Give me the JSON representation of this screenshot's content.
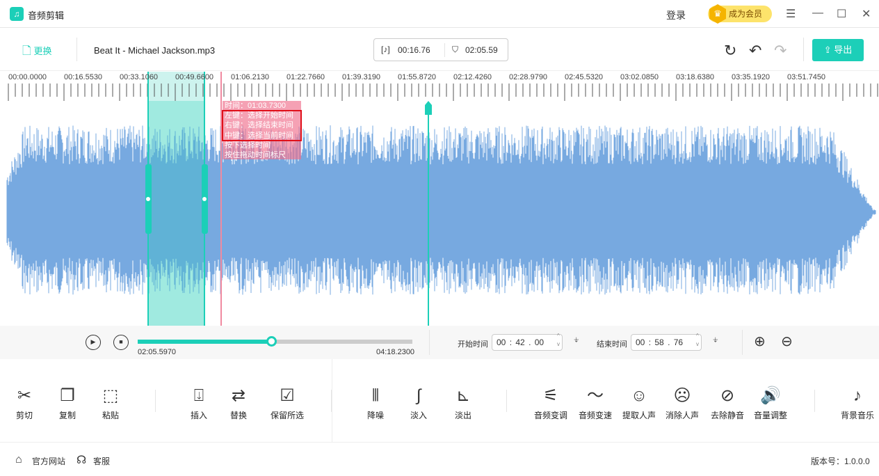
{
  "app": {
    "title": "音频剪辑",
    "login": "登录",
    "vip": "成为会员"
  },
  "toolbar": {
    "replace": "更换",
    "filename": "Beat It - Michael Jackson.mp3",
    "selection_length": "00:16.76",
    "current_time": "02:05.59",
    "export": "导出"
  },
  "ruler": {
    "labels": [
      "00:00.0000",
      "00:16.5530",
      "00:33.1060",
      "00:49.6600",
      "01:06.2130",
      "01:22.7660",
      "01:39.3190",
      "01:55.8720",
      "02:12.4260",
      "02:28.9790",
      "02:45.5320",
      "03:02.0850",
      "03:18.6380",
      "03:35.1920",
      "03:51.7450"
    ]
  },
  "hint": {
    "time": "时间：01:03.7300",
    "lines": [
      "左键：选择开始时间",
      "右键：选择结束时间",
      "中键：选择当前时间",
      "按下选择时间",
      "按住拖动时间标尺"
    ]
  },
  "player": {
    "position": "02:05.5970",
    "duration": "04:18.2300",
    "progress": 0.487,
    "start_label": "开始时间",
    "start": [
      "00",
      "42",
      "00"
    ],
    "end_label": "结束时间",
    "end": [
      "00",
      "58",
      "76"
    ]
  },
  "tools": [
    "剪切",
    "复制",
    "粘贴",
    "插入",
    "替换",
    "保留所选",
    "降噪",
    "淡入",
    "淡出",
    "音频变调",
    "音频变速",
    "提取人声",
    "消除人声",
    "去除静音",
    "音量调整",
    "背景音乐"
  ],
  "footer": {
    "website": "官方网站",
    "service": "客服",
    "version": "版本号：1.0.0.0"
  },
  "colors": {
    "accent": "#1ccfb8",
    "wave": "#77a9e0",
    "marker": "#f08aa0"
  }
}
